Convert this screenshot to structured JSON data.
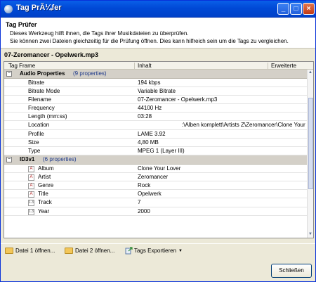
{
  "window": {
    "title": "Tag PrÃ¼fer"
  },
  "header": {
    "title": "Tag Prüfer",
    "line1": "Dieses Werkzeug hilft ihnen, die Tags ihrer Musikdateien zu überprüfen.",
    "line2": "Sie können zwei Dateien gleichzeitig für die Prüfung öffnen. Dies kann hilfreich sein um die Tags zu vergleichen."
  },
  "file": {
    "name": "07-Zeromancer - Opelwerk.mp3"
  },
  "columns": {
    "c1": "Tag Frame",
    "c2": "Inhalt",
    "c3": "Erweiterte Eigensc"
  },
  "groups": [
    {
      "title": "Audio Properties",
      "count": "(9 properties)",
      "rows": [
        {
          "name": "Bitrate",
          "value": "194 kbps"
        },
        {
          "name": "Bitrate Mode",
          "value": "Variable Bitrate"
        },
        {
          "name": "Filename",
          "value": "07-Zeromancer - Opelwerk.mp3"
        },
        {
          "name": "Frequency",
          "value": "44100 Hz"
        },
        {
          "name": "Length (mm:ss)",
          "value": "03:28"
        },
        {
          "name": "Location",
          "value": ":\\Alben komplett\\Artists Z\\Zeromancer\\Clone Your Lover\\"
        },
        {
          "name": "Profile",
          "value": "LAME 3.92"
        },
        {
          "name": "Size",
          "value": "4,80 MB"
        },
        {
          "name": "Type",
          "value": "MPEG 1 (Layer III)"
        }
      ]
    },
    {
      "title": "ID3v1",
      "count": "(6 properties)",
      "rows": [
        {
          "name": "Album",
          "value": "Clone Your Lover",
          "icon": "A"
        },
        {
          "name": "Artist",
          "value": "Zeromancer",
          "icon": "A"
        },
        {
          "name": "Genre",
          "value": "Rock",
          "icon": "A"
        },
        {
          "name": "Title",
          "value": "Opelwerk",
          "icon": "A"
        },
        {
          "name": "Track",
          "value": "7",
          "icon": "1.3"
        },
        {
          "name": "Year",
          "value": "2000",
          "icon": "1.3"
        }
      ]
    }
  ],
  "toolbar": {
    "open1": "Datei 1 öffnen...",
    "open2": "Datei 2 öffnen...",
    "export": "Tags Exportieren"
  },
  "buttons": {
    "close": "Schließen"
  },
  "colors": {
    "titlebar": "#0a5fe8",
    "group_bg": "#d4d0c8",
    "accent": "#1f3a8a"
  }
}
